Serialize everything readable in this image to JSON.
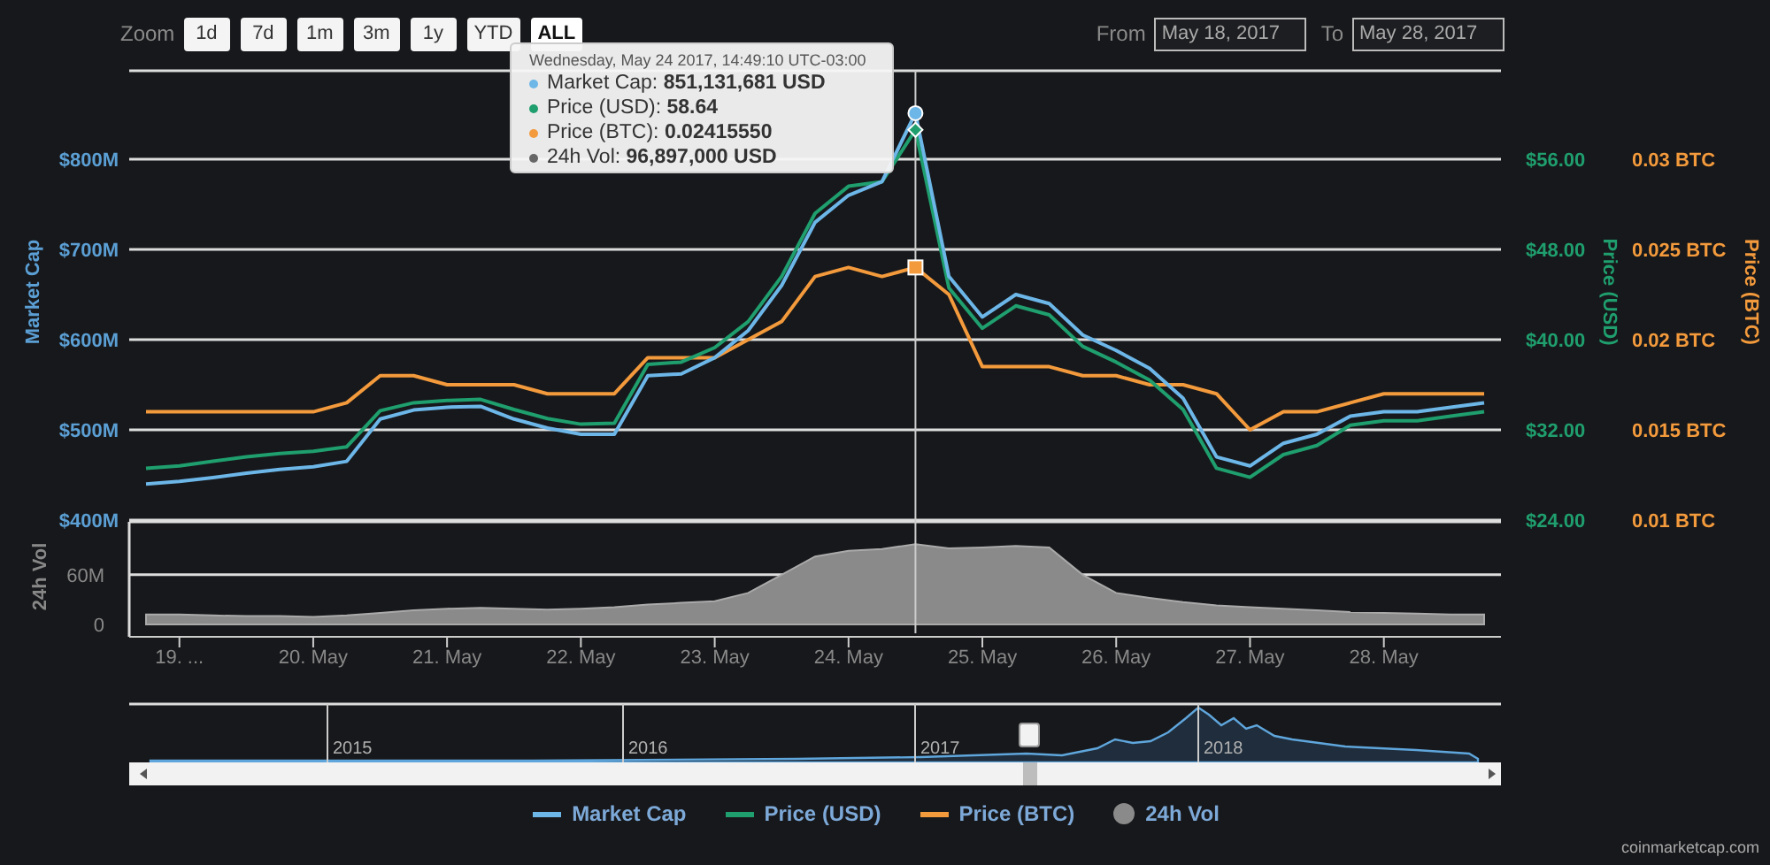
{
  "toolbar": {
    "zoom_label": "Zoom",
    "zoom_buttons": [
      {
        "label": "1d",
        "selected": false
      },
      {
        "label": "7d",
        "selected": false
      },
      {
        "label": "1m",
        "selected": false
      },
      {
        "label": "3m",
        "selected": false
      },
      {
        "label": "1y",
        "selected": false
      },
      {
        "label": "YTD",
        "selected": false
      },
      {
        "label": "ALL",
        "selected": true
      }
    ],
    "from_label": "From",
    "from_date": "May 18, 2017",
    "to_label": "To",
    "to_date": "May 28, 2017"
  },
  "price_chart": {
    "chart_data": {
      "type": "line",
      "ylabel": "Market Cap",
      "categories": [
        null,
        "19. ...",
        null,
        null,
        null,
        "20. May",
        null,
        null,
        null,
        "21. May",
        null,
        null,
        null,
        "22. May",
        null,
        null,
        null,
        "23. May",
        null,
        null,
        null,
        "24. May",
        null,
        null,
        null,
        "25. May",
        null,
        null,
        null,
        "26. May",
        null,
        null,
        null,
        "27. May",
        null,
        null,
        null,
        "28. May",
        null,
        null,
        null
      ],
      "grid": true,
      "ylim": [
        400,
        898
      ],
      "yticks": [
        {
          "value": 400,
          "label": "$400M"
        },
        {
          "value": 500,
          "label": "$500M"
        },
        {
          "value": 600,
          "label": "$600M"
        },
        {
          "value": 700,
          "label": "$700M"
        },
        {
          "value": 800,
          "label": "$800M"
        }
      ],
      "y2label": "Price (USD)",
      "y2lim": [
        24,
        63.84
      ],
      "y2ticks": [
        {
          "value": 24,
          "label": "$24.00"
        },
        {
          "value": 32,
          "label": "$32.00"
        },
        {
          "value": 40,
          "label": "$40.00"
        },
        {
          "value": 48,
          "label": "$48.00"
        },
        {
          "value": 56,
          "label": "$56.00"
        }
      ],
      "y3label": "Price (BTC)",
      "y3lim": [
        0.01,
        0.0349
      ],
      "y3ticks": [
        {
          "value": 0.01,
          "label": "0.01 BTC"
        },
        {
          "value": 0.015,
          "label": "0.015 BTC"
        },
        {
          "value": 0.02,
          "label": "0.02 BTC"
        },
        {
          "value": 0.025,
          "label": "0.025 BTC"
        },
        {
          "value": 0.03,
          "label": "0.03 BTC"
        }
      ],
      "series": [
        {
          "name": "Market Cap",
          "color": "#6cb6e8",
          "values": [
            440,
            443,
            447,
            452,
            456,
            459,
            465,
            512,
            522,
            525,
            526,
            512,
            502,
            495,
            495,
            560,
            562,
            580,
            610,
            660,
            730,
            760,
            775,
            851,
            670,
            625,
            650,
            640,
            605,
            588,
            568,
            535,
            470,
            460,
            485,
            495,
            515,
            520,
            520,
            525,
            530
          ]
        },
        {
          "name": "Price (USD)",
          "color": "#1f9e6e",
          "axis": "y2",
          "values": [
            28.6,
            28.8,
            29.2,
            29.6,
            29.9,
            30.1,
            30.5,
            33.7,
            34.4,
            34.6,
            34.7,
            33.8,
            33.0,
            32.5,
            32.6,
            37.8,
            38.0,
            39.3,
            41.6,
            45.6,
            51.2,
            53.6,
            54.0,
            58.6,
            44.6,
            41.0,
            43.0,
            42.2,
            39.4,
            38.0,
            36.4,
            33.8,
            28.6,
            27.8,
            29.8,
            30.6,
            32.4,
            32.8,
            32.8,
            33.2,
            33.6
          ]
        },
        {
          "name": "Price (BTC)",
          "color": "#f39a3c",
          "axis": "y3",
          "values": [
            0.016,
            0.016,
            0.016,
            0.016,
            0.016,
            0.016,
            0.0165,
            0.018,
            0.018,
            0.0175,
            0.0175,
            0.0175,
            0.017,
            0.017,
            0.017,
            0.019,
            0.019,
            0.019,
            0.02,
            0.021,
            0.0235,
            0.024,
            0.0235,
            0.024,
            0.0225,
            0.0185,
            0.0185,
            0.0185,
            0.018,
            0.018,
            0.0175,
            0.0175,
            0.017,
            0.015,
            0.016,
            0.016,
            0.0165,
            0.017,
            0.017,
            0.017,
            0.017
          ]
        }
      ],
      "xlabel": null
    }
  },
  "volume_chart": {
    "chart_data": {
      "type": "area",
      "ylabel": "24h Vol",
      "ylim": [
        0,
        124
      ],
      "yticks": [
        {
          "value": 0,
          "label": "0"
        },
        {
          "value": 60,
          "label": "60M"
        }
      ],
      "series": [
        {
          "name": "24h Vol",
          "color": "#8a8a8a",
          "values": [
            12,
            12,
            11,
            10,
            10,
            9,
            11,
            14,
            17,
            19,
            20,
            19,
            18,
            19,
            21,
            24,
            26,
            28,
            38,
            60,
            82,
            89,
            91,
            97,
            92,
            93,
            95,
            93,
            60,
            38,
            32,
            27,
            23,
            21,
            19,
            17,
            15,
            14,
            13,
            12,
            12
          ]
        }
      ]
    }
  },
  "navigator": {
    "year_labels": [
      "2015",
      "2016",
      "2017",
      "2018"
    ]
  },
  "tooltip": {
    "title": "Wednesday, May 24 2017, 14:49:10 UTC-03:00",
    "rows": [
      {
        "text": "Market Cap: **851,131,681 USD**",
        "color": "#6cb6e8"
      },
      {
        "text": "Price (USD): **58.64**",
        "color": "#1f9e6e"
      },
      {
        "text": "Price (BTC): **0.02415550**",
        "color": "#f39a3c"
      },
      {
        "text": "24h Vol: **96,897,000 USD**",
        "color": "#666666"
      }
    ]
  },
  "credit": "coinmarketcap.com"
}
